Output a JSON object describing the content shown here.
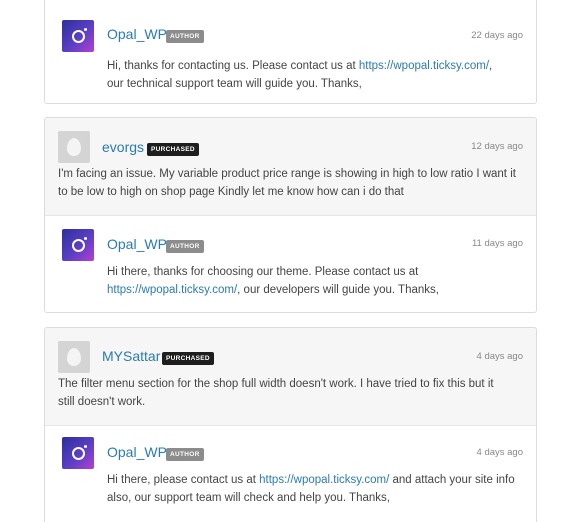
{
  "threads": [
    {
      "question": null,
      "reply": {
        "name": "Opal_WP",
        "badge": "AUTHOR",
        "time": "22 days ago",
        "body_before": "Hi, thanks for contacting us. Please contact us at ",
        "link": "https://wpopal.ticksy.com/",
        "body_after": ", our technical support team will guide you. Thanks,"
      }
    },
    {
      "question": {
        "name": "evorgs",
        "badge": "PURCHASED",
        "time": "12 days ago",
        "body": "I'm facing an issue. My variable product price range is showing in high to low ratio I want it to be low to high on shop page Kindly let me know how can i do that"
      },
      "reply": {
        "name": "Opal_WP",
        "badge": "AUTHOR",
        "time": "11 days ago",
        "body_before": "Hi there, thanks for choosing our theme. Please contact us at ",
        "link": "https://wpopal.ticksy.com/",
        "body_after": ", our developers will guide you. Thanks,"
      }
    },
    {
      "question": {
        "name": "MYSattar",
        "badge": "PURCHASED",
        "time": "4 days ago",
        "body": "The filter menu section for the shop full width doesn't work. I have tried to fix this but it still doesn't work."
      },
      "reply": {
        "name": "Opal_WP",
        "badge": "AUTHOR",
        "time": "4 days ago",
        "body_before": "Hi there, please contact us at ",
        "link": "https://wpopal.ticksy.com/",
        "body_after": " and attach your site info also, our support team will check and help you. Thanks,"
      }
    }
  ]
}
